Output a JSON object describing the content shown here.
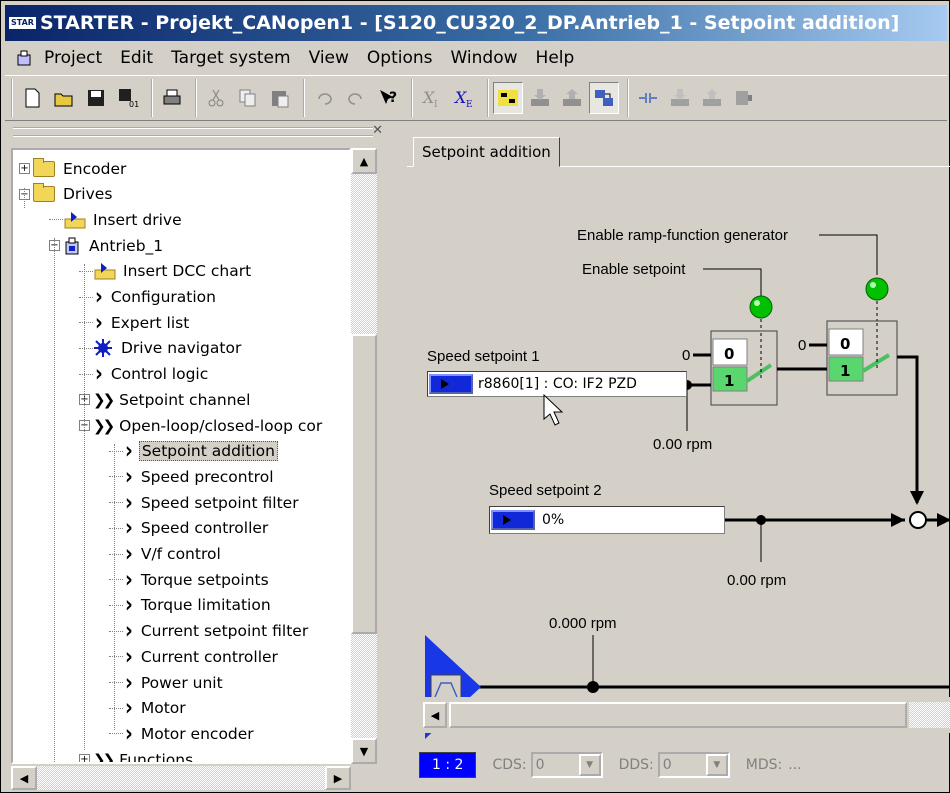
{
  "window": {
    "app_badge": "STAR",
    "title": "STARTER - Projekt_CANopen1 - [S120_CU320_2_DP.Antrieb_1 - Setpoint addition]"
  },
  "menu": [
    "Project",
    "Edit",
    "Target system",
    "View",
    "Options",
    "Window",
    "Help"
  ],
  "toolbar": {
    "icons": [
      "new-icon",
      "open-icon",
      "save-icon",
      "save-compile-icon",
      "print-icon",
      "cut-icon",
      "copy-icon",
      "paste-icon",
      "undo-icon",
      "redo-icon",
      "help-icon",
      "xi-icon",
      "xe-icon",
      "connect-icon",
      "download-icon",
      "upload-icon",
      "online-icon",
      "compare-icon",
      "download-cpu-icon",
      "upload-cpu-icon",
      "more-icon"
    ],
    "xi_label": "X",
    "xi_sub": "I",
    "xe_label": "X",
    "xe_sub": "E"
  },
  "tree": {
    "items": [
      {
        "label": "Encoder",
        "level": 0,
        "kind": "folder",
        "expander": "+"
      },
      {
        "label": "Drives",
        "level": 0,
        "kind": "folder",
        "expander": "-"
      },
      {
        "label": "Insert drive",
        "level": 1,
        "kind": "insert"
      },
      {
        "label": "Antrieb_1",
        "level": 1,
        "kind": "drive",
        "expander": "-"
      },
      {
        "label": "Insert DCC chart",
        "level": 2,
        "kind": "insert"
      },
      {
        "label": "Configuration",
        "level": 2,
        "kind": "chevron"
      },
      {
        "label": "Expert list",
        "level": 2,
        "kind": "chevron"
      },
      {
        "label": "Drive navigator",
        "level": 2,
        "kind": "navigator"
      },
      {
        "label": "Control logic",
        "level": 2,
        "kind": "chevron"
      },
      {
        "label": "Setpoint channel",
        "level": 2,
        "kind": "double",
        "expander": "+"
      },
      {
        "label": "Open-loop/closed-loop cor",
        "level": 2,
        "kind": "double",
        "expander": "-"
      },
      {
        "label": "Setpoint addition",
        "level": 3,
        "kind": "chevron",
        "selected": true
      },
      {
        "label": "Speed precontrol",
        "level": 3,
        "kind": "chevron"
      },
      {
        "label": "Speed setpoint filter",
        "level": 3,
        "kind": "chevron"
      },
      {
        "label": "Speed controller",
        "level": 3,
        "kind": "chevron"
      },
      {
        "label": "V/f control",
        "level": 3,
        "kind": "chevron"
      },
      {
        "label": "Torque setpoints",
        "level": 3,
        "kind": "chevron"
      },
      {
        "label": "Torque limitation",
        "level": 3,
        "kind": "chevron"
      },
      {
        "label": "Current setpoint filter",
        "level": 3,
        "kind": "chevron"
      },
      {
        "label": "Current controller",
        "level": 3,
        "kind": "chevron"
      },
      {
        "label": "Power unit",
        "level": 3,
        "kind": "chevron"
      },
      {
        "label": "Motor",
        "level": 3,
        "kind": "chevron"
      },
      {
        "label": "Motor encoder",
        "level": 3,
        "kind": "chevron"
      },
      {
        "label": "Functions",
        "level": 2,
        "kind": "double",
        "expander": "+"
      }
    ]
  },
  "editor": {
    "tab_label": "Setpoint addition",
    "enable_rfg_label": "Enable ramp-function generator",
    "enable_setpoint_label": "Enable setpoint",
    "speed_setpoint_1_label": "Speed setpoint 1",
    "speed_setpoint_1_value": "r8860[1] : CO: IF2 PZD",
    "speed_setpoint_1_rpm": "0.00 rpm",
    "speed_setpoint_2_label": "Speed setpoint 2",
    "speed_setpoint_2_value": "0%",
    "speed_setpoint_2_rpm": "0.00 rpm",
    "bottom_rpm": "0.000 rpm",
    "switch_zero": "0",
    "switch_one": "1",
    "zero_input": "0"
  },
  "statusbar": {
    "ratio": "1 : 2",
    "cds_label": "CDS:",
    "cds_value": "0",
    "dds_label": "DDS:",
    "dds_value": "0",
    "mds_label": "MDS:",
    "mds_value": "..."
  },
  "colors": {
    "connector_blue": "#1028d8",
    "switch_green": "#5ad66e",
    "led_green": "#00c000",
    "title_blue": "#0a246a"
  }
}
